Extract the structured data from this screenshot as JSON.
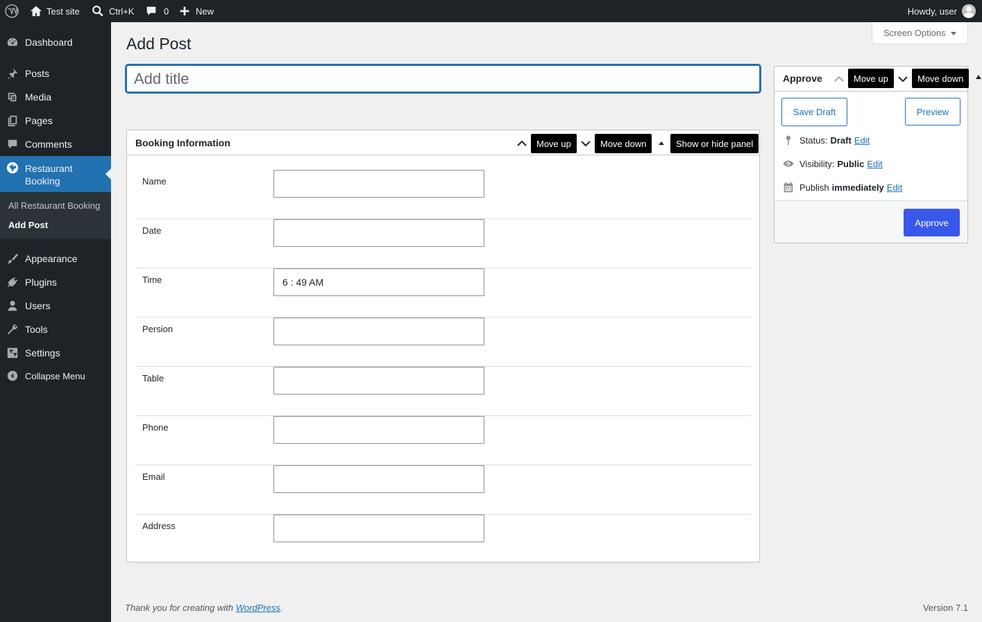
{
  "adminbar": {
    "site_name": "Test site",
    "search_shortcut": "Ctrl+K",
    "comments_count": "0",
    "new_label": "New",
    "greeting": "Howdy, user"
  },
  "sidebar": {
    "items": [
      {
        "label": "Dashboard",
        "icon": "dashboard-icon"
      },
      {
        "label": "Posts",
        "icon": "pushpin-icon"
      },
      {
        "label": "Media",
        "icon": "media-icon"
      },
      {
        "label": "Pages",
        "icon": "pages-icon"
      },
      {
        "label": "Comments",
        "icon": "comments-icon"
      },
      {
        "label": "Restaurant Booking",
        "icon": "globe-icon",
        "current": true
      },
      {
        "label": "Appearance",
        "icon": "paintbrush-icon"
      },
      {
        "label": "Plugins",
        "icon": "plugins-icon"
      },
      {
        "label": "Users",
        "icon": "users-icon"
      },
      {
        "label": "Tools",
        "icon": "wrench-icon"
      },
      {
        "label": "Settings",
        "icon": "settings-icon"
      },
      {
        "label": "Collapse Menu",
        "icon": "collapse-icon"
      }
    ],
    "submenu": {
      "all": "All Restaurant Booking",
      "add": "Add Post"
    }
  },
  "screen_options": "Screen Options",
  "page_title": "Add Post",
  "title_placeholder": "Add title",
  "booking": {
    "title": "Booking Information",
    "move_up": "Move up",
    "move_down": "Move down",
    "toggle": "Show or hide panel",
    "fields": [
      {
        "label": "Name",
        "value": ""
      },
      {
        "label": "Date",
        "value": ""
      },
      {
        "label": "Time",
        "value": "6 : 49 AM"
      },
      {
        "label": "Persion",
        "value": ""
      },
      {
        "label": "Table",
        "value": ""
      },
      {
        "label": "Phone",
        "value": ""
      },
      {
        "label": "Email",
        "value": ""
      },
      {
        "label": "Address",
        "value": ""
      }
    ]
  },
  "publish": {
    "title": "Approve",
    "move_up": "Move up",
    "move_down": "Move down",
    "save_draft": "Save Draft",
    "preview": "Preview",
    "status_label": "Status:",
    "status_value": "Draft",
    "visibility_label": "Visibility:",
    "visibility_value": "Public",
    "publish_label": "Publish",
    "publish_value": "immediately",
    "edit": "Edit",
    "approve_button": "Approve"
  },
  "footer": {
    "thanks_prefix": "Thank you for creating with",
    "wordpress": "WordPress",
    "thanks_suffix": ".",
    "version": "Version 7.1"
  },
  "colors": {
    "accent": "#2271b1",
    "primary_button": "#3858e9",
    "sidebar_bg": "#1d2327",
    "current_menu": "#2271b1"
  }
}
